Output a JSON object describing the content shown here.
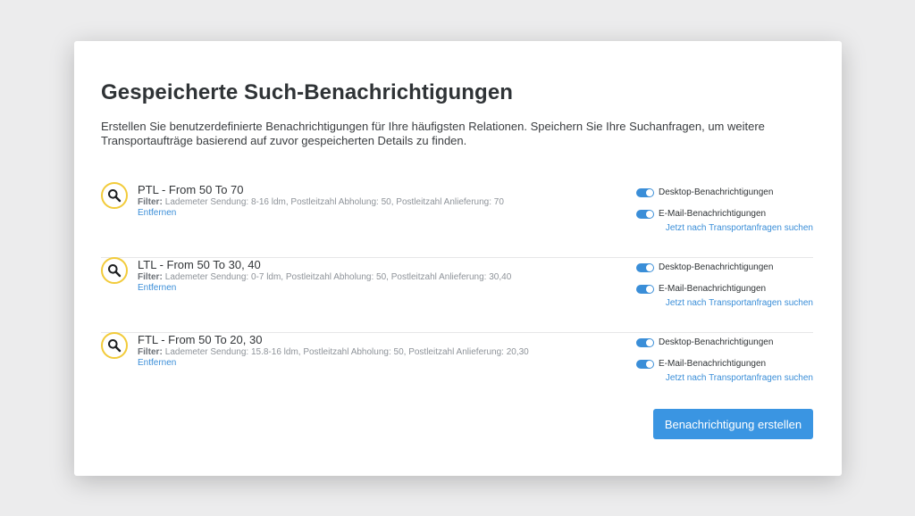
{
  "page": {
    "title": "Gespeicherte Such-Benachrichtigungen",
    "description": "Erstellen Sie benutzerdefinierte Benachrichtigungen für Ihre häufigsten Relationen. Speichern Sie Ihre Suchanfragen, um weitere Transportaufträge basierend auf zuvor gespeicherten Details zu finden."
  },
  "alerts": [
    {
      "title": "PTL - From 50 To 70",
      "filter_label": "Filter:",
      "filter_text": "Lademeter Sendung: 8-16 ldm, Postleitzahl Abholung: 50, Postleitzahl Anlieferung: 70",
      "remove_label": "Entfernen",
      "desktop_label": "Desktop-Benachrichtigungen",
      "email_label": "E-Mail-Benachrichtigungen",
      "search_link": "Jetzt nach Transportanfragen suchen"
    },
    {
      "title": "LTL - From 50 To 30, 40",
      "filter_label": "Filter:",
      "filter_text": "Lademeter Sendung: 0-7 ldm, Postleitzahl Abholung: 50, Postleitzahl Anlieferung: 30,40",
      "remove_label": "Entfernen",
      "desktop_label": "Desktop-Benachrichtigungen",
      "email_label": "E-Mail-Benachrichtigungen",
      "search_link": "Jetzt nach Transportanfragen suchen"
    },
    {
      "title": "FTL - From 50 To 20, 30",
      "filter_label": "Filter:",
      "filter_text": "Lademeter Sendung: 15.8-16 ldm, Postleitzahl Abholung: 50, Postleitzahl Anlieferung: 20,30",
      "remove_label": "Entfernen",
      "desktop_label": "Desktop-Benachrichtigungen",
      "email_label": "E-Mail-Benachrichtigungen",
      "search_link": "Jetzt nach Transportanfragen suchen"
    }
  ],
  "actions": {
    "create_label": "Benachrichtigung erstellen"
  },
  "colors": {
    "accent": "#3a8ed8",
    "button": "#3a95e2",
    "icon_ring": "#f2cb3a"
  },
  "icons": {
    "alert": "search-icon"
  }
}
